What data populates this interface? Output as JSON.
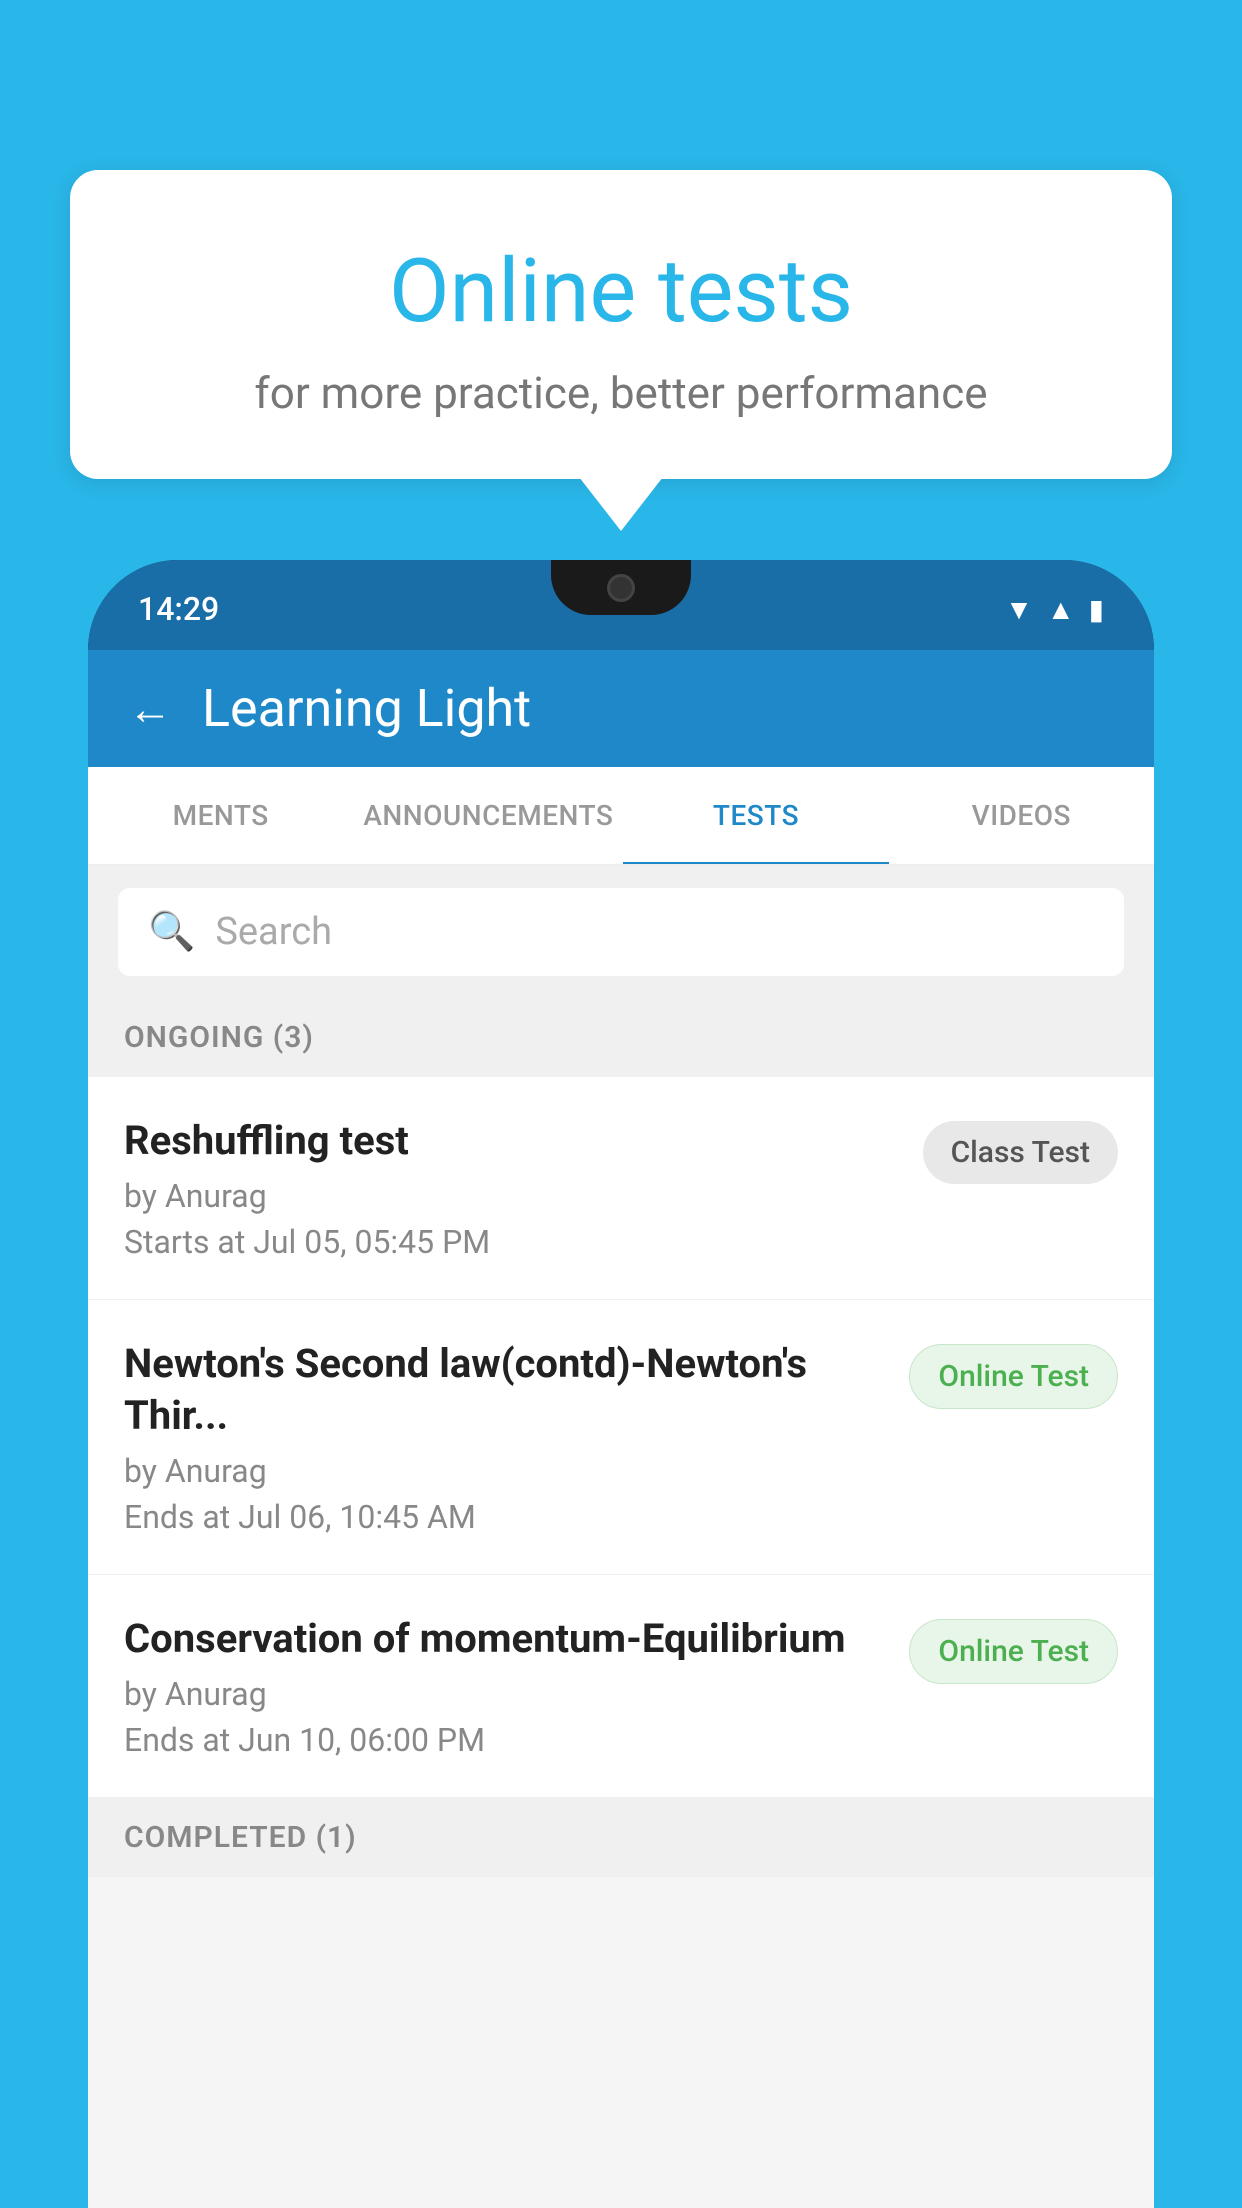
{
  "background_color": "#29b6e8",
  "speech_bubble": {
    "title": "Online tests",
    "subtitle": "for more practice, better performance"
  },
  "phone": {
    "status_bar": {
      "time": "14:29"
    },
    "header": {
      "title": "Learning Light",
      "back_label": "←"
    },
    "tabs": [
      {
        "label": "MENTS",
        "active": false
      },
      {
        "label": "ANNOUNCEMENTS",
        "active": false
      },
      {
        "label": "TESTS",
        "active": true
      },
      {
        "label": "VIDEOS",
        "active": false
      }
    ],
    "search": {
      "placeholder": "Search"
    },
    "section_ongoing": {
      "label": "ONGOING (3)"
    },
    "tests": [
      {
        "name": "Reshuffling test",
        "by": "by Anurag",
        "date": "Starts at  Jul 05, 05:45 PM",
        "badge": "Class Test",
        "badge_type": "class"
      },
      {
        "name": "Newton's Second law(contd)-Newton's Thir...",
        "by": "by Anurag",
        "date": "Ends at  Jul 06, 10:45 AM",
        "badge": "Online Test",
        "badge_type": "online"
      },
      {
        "name": "Conservation of momentum-Equilibrium",
        "by": "by Anurag",
        "date": "Ends at  Jun 10, 06:00 PM",
        "badge": "Online Test",
        "badge_type": "online"
      }
    ],
    "section_completed": {
      "label": "COMPLETED (1)"
    }
  }
}
